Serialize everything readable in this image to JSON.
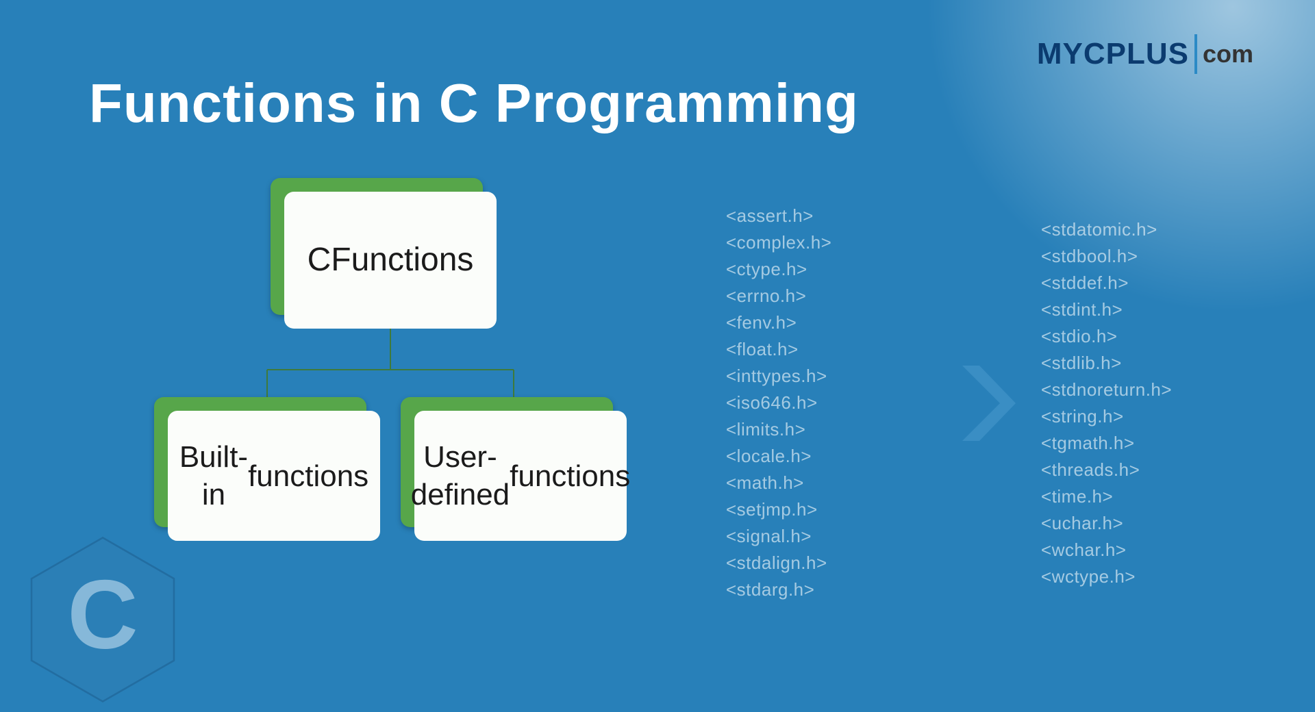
{
  "title": "Functions in C Programming",
  "logo": {
    "left": "MYCPLUS",
    "right": "com"
  },
  "diagram": {
    "root": "C\nFunctions",
    "leftChild": "Built-in\nfunctions",
    "rightChild": "User-defined\nfunctions"
  },
  "headers": {
    "col1": [
      "<assert.h>",
      "<complex.h>",
      "<ctype.h>",
      "<errno.h>",
      "<fenv.h>",
      "<float.h>",
      "<inttypes.h>",
      "<iso646.h>",
      "<limits.h>",
      "<locale.h>",
      "<math.h>",
      "<setjmp.h>",
      "<signal.h>",
      "<stdalign.h>",
      "<stdarg.h>"
    ],
    "col2": [
      "<stdatomic.h>",
      "<stdbool.h>",
      "<stddef.h>",
      "<stdint.h>",
      "<stdio.h>",
      "<stdlib.h>",
      "<stdnoreturn.h>",
      "<string.h>",
      "<tgmath.h>",
      "<threads.h>",
      "<time.h>",
      "<uchar.h>",
      "<wchar.h>",
      "<wctype.h>"
    ]
  },
  "corner_logo_letter": "C"
}
